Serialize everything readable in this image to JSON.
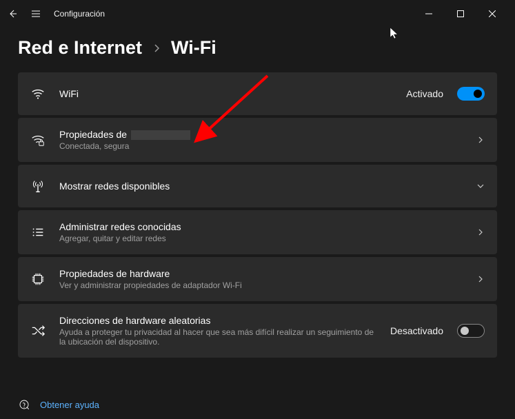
{
  "titlebar": {
    "title": "Configuración"
  },
  "breadcrumb": {
    "parent": "Red e Internet",
    "current": "Wi-Fi"
  },
  "rows": {
    "wifi": {
      "title": "WiFi",
      "state": "Activado"
    },
    "properties": {
      "title_prefix": "Propiedades de ",
      "sub": "Conectada, segura"
    },
    "available": {
      "title": "Mostrar redes disponibles"
    },
    "known": {
      "title": "Administrar redes conocidas",
      "sub": "Agregar, quitar y editar redes"
    },
    "hardware": {
      "title": "Propiedades de hardware",
      "sub": "Ver y administrar propiedades de adaptador Wi-Fi"
    },
    "random": {
      "title": "Direcciones de hardware aleatorias",
      "sub": "Ayuda a proteger tu privacidad al hacer que sea más difícil realizar un seguimiento de la ubicación del dispositivo.",
      "state": "Desactivado"
    }
  },
  "help": {
    "label": "Obtener ayuda"
  }
}
